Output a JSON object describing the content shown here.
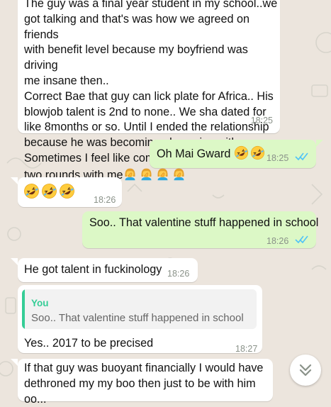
{
  "messages": [
    {
      "id": "m1",
      "direction": "incoming",
      "lines": [
        "The guy was a final year student in my school..we",
        "got talking and that's was how we agreed on friends",
        "with benefit level because my boyfriend was driving",
        "me insane then..",
        "Correct Bae that guy can lick plate for Africa.. His",
        "blowjob talent is 2nd to none.. We sha dated for",
        "like 8months or so. Until I ended the relationship",
        "because he was becoming obsessive with me..",
        "Sometimes I feel like coming him to have one or"
      ],
      "last_line": "two rounds with me",
      "emoji": [
        "woman-facepalming",
        "woman-facepalming",
        "woman-facepalming",
        "woman-facepalming"
      ],
      "time": "18:25"
    },
    {
      "id": "m2",
      "direction": "outgoing",
      "text": "Oh Mai Gward",
      "emoji": [
        "rolling-on-floor-laughing",
        "rolling-on-floor-laughing"
      ],
      "time": "18:25",
      "status": "read"
    },
    {
      "id": "m3",
      "direction": "incoming",
      "text": "",
      "emoji": [
        "rolling-on-floor-laughing",
        "rolling-on-floor-laughing",
        "rolling-on-floor-laughing"
      ],
      "time": "18:26"
    },
    {
      "id": "m4",
      "direction": "outgoing",
      "text": "Soo.. That valentine stuff happened in school",
      "time": "18:26",
      "status": "read"
    },
    {
      "id": "m5",
      "direction": "incoming",
      "text": "He got talent in fuckinology",
      "time": "18:26"
    },
    {
      "id": "m6",
      "direction": "incoming",
      "quote": {
        "author": "You",
        "text": "Soo.. That valentine stuff happened in school"
      },
      "text": "Yes.. 2017 to be precised",
      "time": "18:27"
    },
    {
      "id": "m7",
      "direction": "incoming",
      "lines": [
        "If that guy was buoyant financially I would have",
        "dethroned my my boo then just to be with him oo..."
      ]
    }
  ],
  "scroll_button": {
    "icon": "double-chevron-down-icon"
  },
  "colors": {
    "background": "#ece5dd",
    "incoming_bubble": "#ffffff",
    "outgoing_bubble": "#dcf8c6",
    "read_ticks": "#4fc3f7",
    "quote_accent": "#35cd96",
    "timestamp": "#8a9289"
  }
}
